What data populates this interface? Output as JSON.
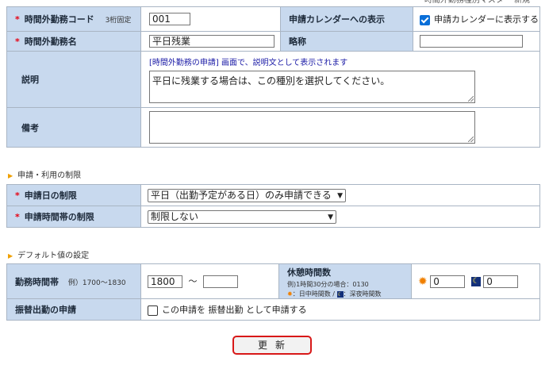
{
  "header": {
    "top_text": "時間外勤務種別マスター 新規"
  },
  "fields": {
    "code": {
      "label": "時間外勤務コード",
      "note": "3桁固定",
      "value": "001"
    },
    "calendar": {
      "label": "申請カレンダーへの表示",
      "checkbox_label": "申請カレンダーに表示する",
      "checked": true
    },
    "name": {
      "label": "時間外勤務名",
      "value": "平日残業"
    },
    "short_name": {
      "label": "略称",
      "value": ""
    },
    "description": {
      "label": "説明",
      "hint": "[時間外勤務の申請] 画面で、説明文として表示されます",
      "value": "平日に残業する場合は、この種別を選択してください。"
    },
    "remarks": {
      "label": "備考",
      "value": ""
    }
  },
  "section_restrictions": {
    "title": "申請・利用の制限"
  },
  "restrictions": {
    "date": {
      "label": "申請日の制限",
      "selected": "平日（出勤予定がある日）のみ申請できる"
    },
    "time": {
      "label": "申請時間帯の制限",
      "selected": "制限しない"
    }
  },
  "section_defaults": {
    "title": "デフォルト値の設定"
  },
  "defaults": {
    "work_time": {
      "label": "勤務時間帯",
      "example": "例）1700～1830",
      "from": "1800",
      "separator": "～",
      "to": ""
    },
    "break": {
      "label": "休憩時間数",
      "example": "例)1時間30分の場合：0130",
      "day_legend": "：日中時間数 /",
      "night_legend": "：深夜時間数",
      "day_value": "0",
      "night_value": "0"
    },
    "substitute": {
      "label": "振替出勤の申請",
      "checkbox_label": "この申請を 振替出勤 として申請する",
      "checked": false
    }
  },
  "actions": {
    "update_label": "更新"
  },
  "colors": {
    "label_bg": "#c8d9ee",
    "required": "#e60012",
    "button_border": "#d81818",
    "link_blue": "#1a1aa6"
  }
}
